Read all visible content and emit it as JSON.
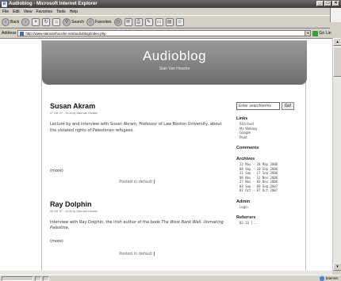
{
  "window": {
    "title": "Audioblog - Microsoft Internet Explorer"
  },
  "menu": [
    "File",
    "Edit",
    "View",
    "Favorites",
    "Tools",
    "Help"
  ],
  "toolbar": {
    "back": "Back",
    "search": "Search",
    "favorites": "Favorites"
  },
  "address": {
    "label": "Address",
    "url": "http://www.stanvanhoucke.net/audioblog/index.php",
    "go": "Go",
    "links": "Lin"
  },
  "blog": {
    "title": "Audioblog",
    "subtitle": "Stan Van Houcke"
  },
  "posts": [
    {
      "title": "Susan Akram",
      "meta": "07 Oct '07 - 15:34 by Stan van Houcke",
      "body": "Lecture by and interview with Susan Akram, Professor of Law  Boston University, about the violated rights of Palestinian refugees.",
      "more": "(more)",
      "posted_prefix": "Posted in default",
      "posted_sep": "|"
    },
    {
      "title": "Ray Dolphin",
      "meta": "06 Oct '07 - 10:40 by Stan van Houcke",
      "body_before": "Interview with Ray Dolphin, the Irish author of the book ",
      "body_italic": "The West Bank Wall. Unmaking Palestine.",
      "more": "(more)",
      "posted_prefix": "Posted in default",
      "posted_sep": "|"
    }
  ],
  "sidebar": {
    "search": {
      "placeholder": "Enter searchterms",
      "button": "Go!"
    },
    "links": {
      "title": "Links",
      "items": [
        "RSS feed",
        "My Weblog",
        "Google",
        "Pivot"
      ]
    },
    "comments": {
      "title": "Comments"
    },
    "archives": {
      "title": "Archives",
      "items": [
        "22 May - 28 May 2006",
        "04 Sep - 10 Sep 2006",
        "11 Sep - 17 Sep 2006",
        "06 Nov - 12 Nov 2006",
        "27 Nov - 03 Dec 2006",
        "03 Sep - 09 Sep 2007",
        "01 Oct - 07 Oct 2007"
      ]
    },
    "admin": {
      "title": "Admin",
      "items": [
        "Login"
      ]
    },
    "referrers": {
      "title": "Referrers",
      "items": [
        "02:33 [..."
      ]
    }
  },
  "status": {
    "zone": "Internet"
  }
}
